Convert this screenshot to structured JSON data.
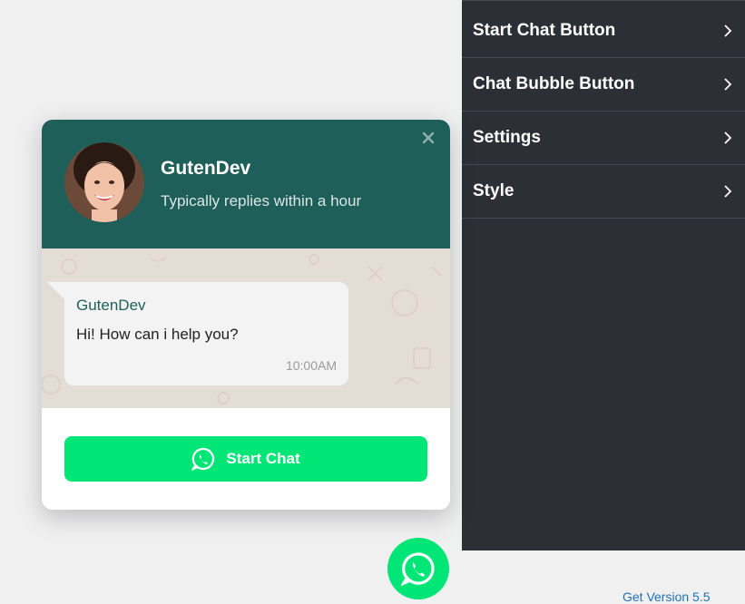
{
  "panel": {
    "items": [
      {
        "label": "Start Chat Button"
      },
      {
        "label": "Chat Bubble Button"
      },
      {
        "label": "Settings"
      },
      {
        "label": "Style"
      }
    ],
    "version_text": "Get Version 5.5"
  },
  "widget": {
    "name": "GutenDev",
    "subtitle": "Typically replies within a hour",
    "message": {
      "sender": "GutenDev",
      "text": "Hi! How can i help you?",
      "time": "10:00AM"
    },
    "button_label": "Start Chat"
  },
  "icons": {
    "close": "close-icon",
    "chevron": "chevron-right-icon",
    "whatsapp": "whatsapp-icon"
  },
  "colors": {
    "header": "#1e5f59",
    "accent_green": "#00e676",
    "panel_bg": "#2c2f36"
  }
}
